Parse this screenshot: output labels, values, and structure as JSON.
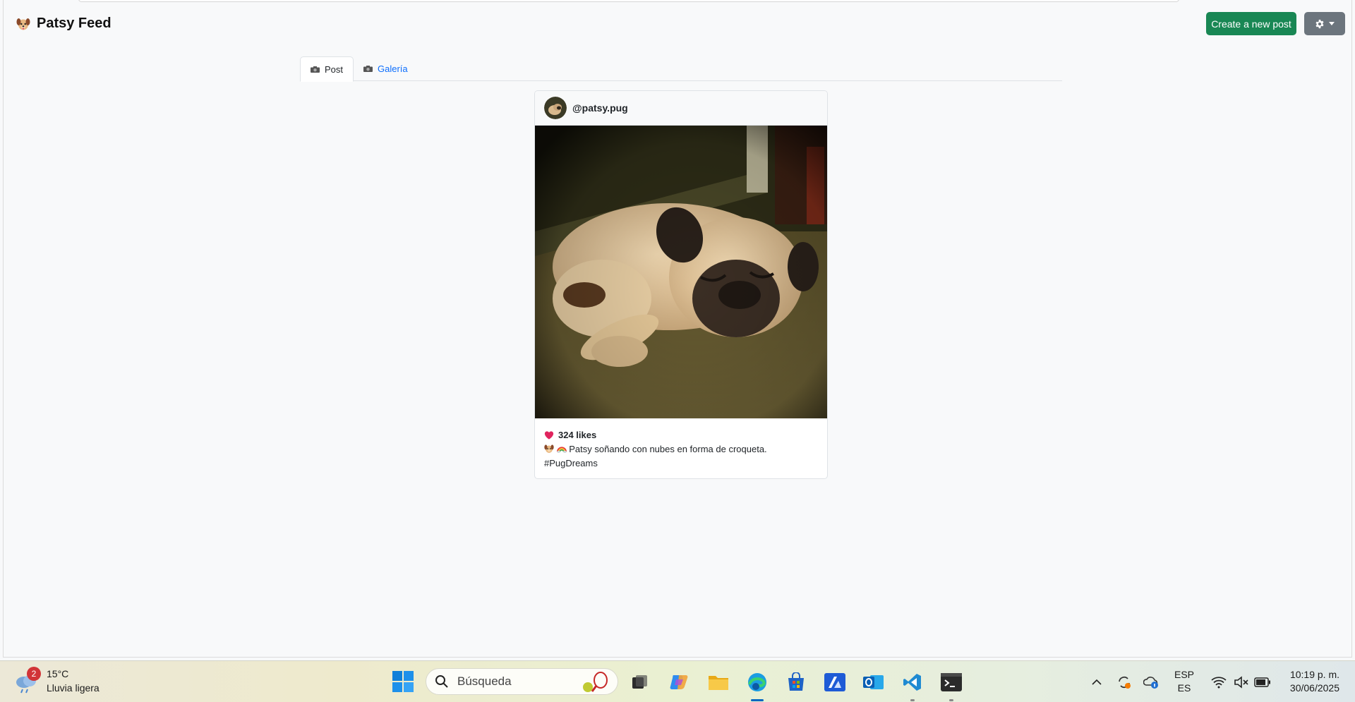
{
  "navbar": {
    "brand": "Patsy Feed",
    "new_post_label": "Create a new post"
  },
  "tabs": [
    {
      "label": "Post",
      "active": true
    },
    {
      "label": "Galería",
      "active": false
    }
  ],
  "post": {
    "username": "@patsy.pug",
    "likes": "324 likes",
    "caption": "Patsy soñando con nubes en forma de croqueta.",
    "hashtag": "#PugDreams"
  },
  "taskbar": {
    "weather": {
      "badge": "2",
      "temperature": "15°C",
      "condition": "Lluvia ligera"
    },
    "search_placeholder": "Búsqueda",
    "language": {
      "top": "ESP",
      "bottom": "ES"
    },
    "time": "10:19 p. m.",
    "date": "30/06/2025",
    "apps": [
      "task-view",
      "copilot",
      "file-explorer",
      "edge",
      "microsoft-store",
      "azure",
      "outlook",
      "vscode",
      "terminal"
    ]
  },
  "colors": {
    "primary": "#0d6efd",
    "success": "#198754",
    "secondary": "#6c757d",
    "heart": "#e0245e"
  }
}
